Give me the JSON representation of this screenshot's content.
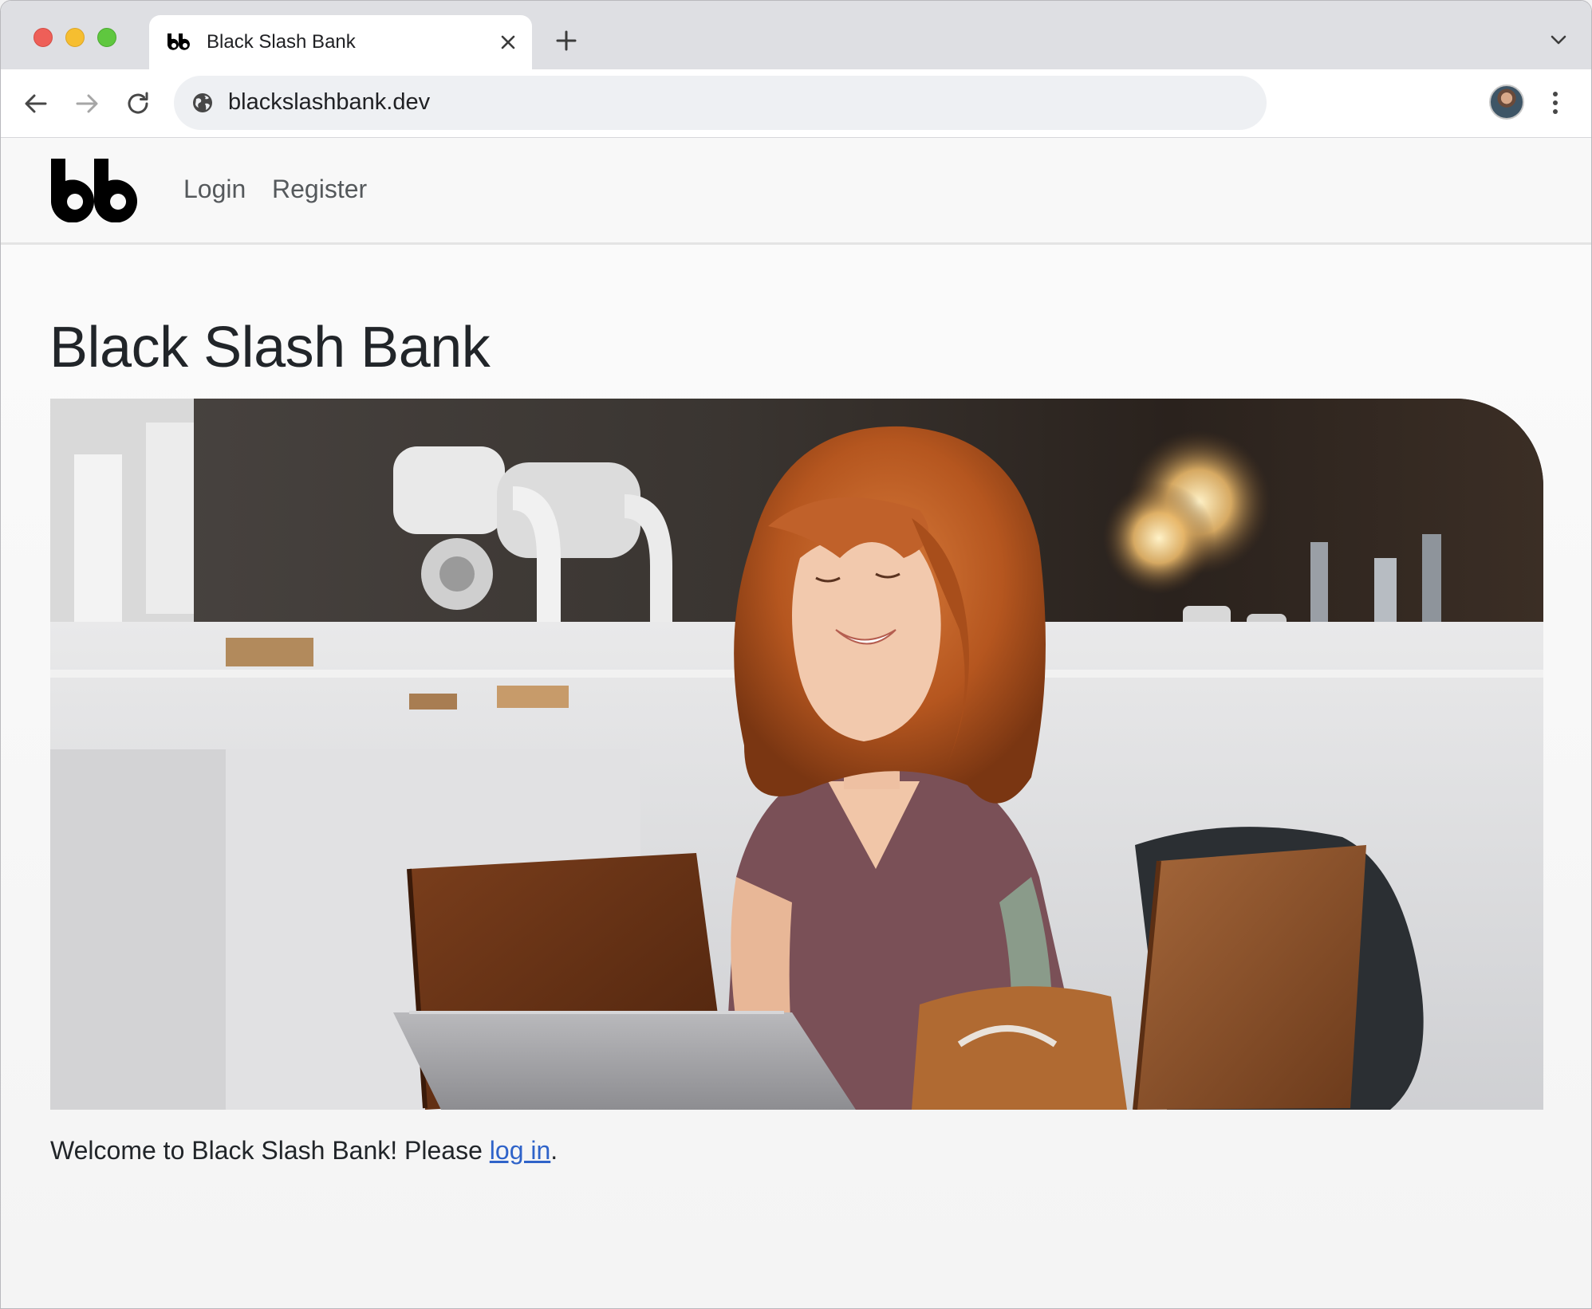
{
  "browser": {
    "tab": {
      "title": "Black Slash Bank",
      "favicon": "bb-logo-icon"
    },
    "address_bar": {
      "url": "blackslashbank.dev",
      "site_icon": "globe-icon"
    },
    "controls": [
      "back-icon",
      "forward-icon",
      "reload-icon",
      "new-tab-icon",
      "tab-search-chevron-icon",
      "more-menu-icon"
    ]
  },
  "site": {
    "logo_alt": "bb",
    "nav": {
      "login": "Login",
      "register": "Register"
    },
    "title": "Black Slash Bank",
    "hero_image_subject": "woman-using-laptop-in-cafe",
    "welcome": {
      "prefix": "Welcome to Black Slash Bank! Please ",
      "link": "log in",
      "suffix": "."
    }
  },
  "colors": {
    "link": "#2f63c9",
    "nav_link": "#55595c",
    "title": "#212529",
    "traffic_red": "#ee5f58",
    "traffic_yellow": "#f6be30",
    "traffic_green": "#5fc73f"
  }
}
